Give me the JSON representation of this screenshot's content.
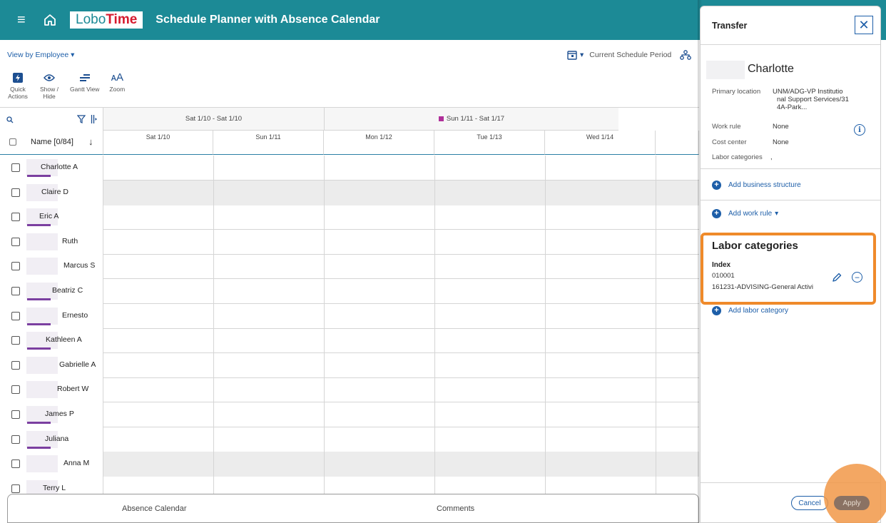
{
  "header": {
    "logo_part1": "Lobo",
    "logo_part2": "Time",
    "title": "Schedule Planner with Absence Calendar"
  },
  "toolbar": {
    "view_by": "View by Employee",
    "tools": [
      {
        "label": "Quick Actions",
        "icon": "lightning-icon"
      },
      {
        "label": "Show / Hide",
        "icon": "eye-icon"
      },
      {
        "label": "Gantt View",
        "icon": "gantt-icon"
      },
      {
        "label": "Zoom",
        "icon": "zoom-text-icon"
      }
    ],
    "period": "Current Schedule Period"
  },
  "grid": {
    "name_header": "Name [0/84]",
    "weeks": [
      "Sat 1/10 - Sat 1/10",
      "Sun 1/11 - Sat 1/17"
    ],
    "days": [
      "Sat 1/10",
      "Sun 1/11",
      "Mon 1/12",
      "Tue 1/13",
      "Wed 1/14"
    ],
    "employees": [
      {
        "name": "Charlotte A",
        "bar": true,
        "shaded": false
      },
      {
        "name": "Claire D",
        "bar": false,
        "shaded": true
      },
      {
        "name": "Eric A",
        "bar": true,
        "shaded": false
      },
      {
        "name": "Ruth",
        "bar": false,
        "shaded": false
      },
      {
        "name": "Marcus S",
        "bar": false,
        "shaded": false
      },
      {
        "name": "Beatriz C",
        "bar": true,
        "shaded": false
      },
      {
        "name": "Ernesto",
        "bar": true,
        "shaded": false
      },
      {
        "name": "Kathleen A",
        "bar": true,
        "shaded": false
      },
      {
        "name": "Gabrielle A",
        "bar": false,
        "shaded": false
      },
      {
        "name": "Robert W",
        "bar": false,
        "shaded": false
      },
      {
        "name": "James P",
        "bar": true,
        "shaded": false
      },
      {
        "name": "Juliana",
        "bar": true,
        "shaded": false
      },
      {
        "name": "Anna M",
        "bar": false,
        "shaded": true
      },
      {
        "name": "Terry L",
        "bar": true,
        "shaded": false
      }
    ]
  },
  "bottom_tabs": [
    "Absence Calendar",
    "Comments"
  ],
  "panel": {
    "title": "Transfer",
    "employee": "Charlotte",
    "primary_location_label": "Primary location",
    "primary_location_lines": [
      "UNM/ADG-VP Institutio",
      "nal Support Services/31",
      "4A-Park..."
    ],
    "work_rule_label": "Work rule",
    "work_rule_value": "None",
    "cost_center_label": "Cost center",
    "cost_center_value": "None",
    "labor_categories_label": "Labor categories",
    "labor_categories_value": ",",
    "add_business_structure": "Add business structure",
    "add_work_rule": "Add work rule",
    "lc_title": "Labor categories",
    "lc_index_label": "Index",
    "lc_index_value": "010001",
    "lc_detail": "161231-ADVISING-General Activi",
    "add_labor_category": "Add labor category",
    "cancel": "Cancel",
    "apply": "Apply"
  },
  "colors": {
    "header": "#1c8a96",
    "brand_red": "#d61a2e",
    "link_blue": "#1d5ea8",
    "highlight_orange": "#ef8a2a",
    "employee_bar": "#7b3fa0",
    "week_marker": "#b0309a"
  }
}
